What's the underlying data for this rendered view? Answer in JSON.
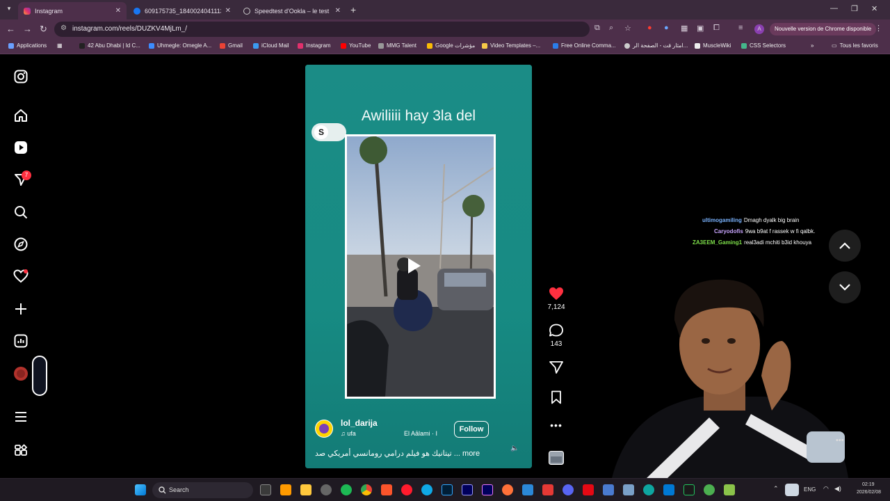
{
  "browser": {
    "tabs": [
      {
        "title": "Instagram",
        "active": true,
        "favicon": "instagram-icon"
      },
      {
        "title": "609175735_18400240411131…",
        "active": false,
        "favicon": "facebook-icon"
      },
      {
        "title": "Speedtest d'Ookla – le test de …",
        "active": false,
        "favicon": "speedtest-icon"
      }
    ],
    "url": "instagram.com/reels/DUZKV4MjLm_/",
    "update_label": "Nouvelle version de Chrome disponible",
    "bookmarks": [
      {
        "label": "Applications",
        "color": "#6aa0ff"
      },
      {
        "label": "42 Abu Dhabi | Id C...",
        "color": "#222222"
      },
      {
        "label": "Uhmegle: Omegle A...",
        "color": "#3c8cff"
      },
      {
        "label": "Gmail",
        "color": "#ea4335"
      },
      {
        "label": "iCloud Mail",
        "color": "#3b9bf0"
      },
      {
        "label": "Instagram",
        "color": "#e1306c"
      },
      {
        "label": "YouTube",
        "color": "#ff0000"
      },
      {
        "label": "MMG Talent",
        "color": "#999999"
      },
      {
        "label": "Google مؤشرات",
        "color": "#fbbc05"
      },
      {
        "label": "Video Templates –...",
        "color": "#f7c948"
      },
      {
        "label": "Free Online Comma...",
        "color": "#2b7de9"
      },
      {
        "label": "امثار قت - الصفحة الر...",
        "color": "#cccccc"
      },
      {
        "label": "MuscleWiki",
        "color": "#eeeeee"
      },
      {
        "label": "CSS Selectors",
        "color": "#44b78b"
      }
    ],
    "all_bookmarks": "Tous les favoris"
  },
  "sidebar": {
    "notification_count": "7"
  },
  "reel": {
    "caption": "Awiliiii hay 3la del",
    "sticker_letter": "S",
    "author": "lol_darija",
    "audio": "♫ ufa",
    "audio_secondary": "El Aālami · I",
    "follow_label": "Follow",
    "description": "تيتانيك هو فيلم درامي رومانسي أمريكي صد ... more",
    "likes": "7,124",
    "comments": "143"
  },
  "chat": [
    {
      "user": "ultimogamiling",
      "message": "Dmagh dyalk big brain",
      "color": "#7ab3ff"
    },
    {
      "user": "Caryodofis",
      "message": "9wa b9at f rassek w fi qalbk.",
      "color": "#c9a6ff"
    },
    {
      "user": "ZA3EEM_Gaming1",
      "message": "real3adi mchiti b3id khouya",
      "color": "#7ee04a"
    }
  ],
  "taskbar": {
    "search_label": "Search",
    "lang": "ENG",
    "time": "02:19",
    "date": "2026/02/08"
  }
}
